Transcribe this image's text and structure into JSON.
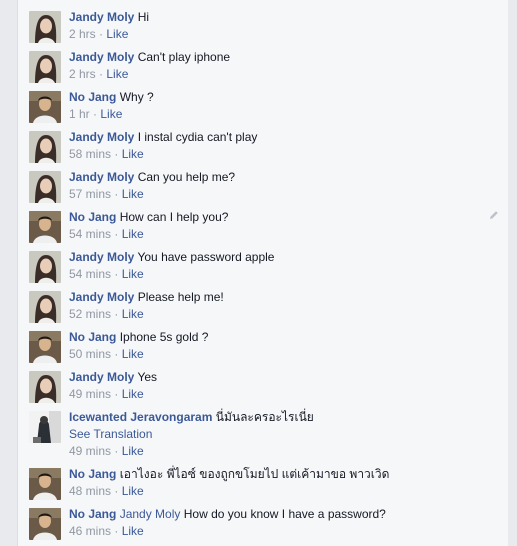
{
  "comments": [
    {
      "author": "Jandy Moly",
      "text": "Hi",
      "time": "2 hrs",
      "like": "Like",
      "avatar": "girl"
    },
    {
      "author": "Jandy Moly",
      "text": "Can't play iphone",
      "time": "2 hrs",
      "like": "Like",
      "avatar": "girl"
    },
    {
      "author": "No Jang",
      "text": "Why ?",
      "time": "1 hr",
      "like": "Like",
      "avatar": "man"
    },
    {
      "author": "Jandy Moly",
      "text": "I instal cydia can't play",
      "time": "58 mins",
      "like": "Like",
      "avatar": "girl"
    },
    {
      "author": "Jandy Moly",
      "text": "Can you help me?",
      "time": "57 mins",
      "like": "Like",
      "avatar": "girl"
    },
    {
      "author": "No Jang",
      "text": "How can I help you?",
      "time": "54 mins",
      "like": "Like",
      "avatar": "man"
    },
    {
      "author": "Jandy Moly",
      "text": "You have password apple",
      "time": "54 mins",
      "like": "Like",
      "avatar": "girl"
    },
    {
      "author": "Jandy Moly",
      "text": "Please help me!",
      "time": "52 mins",
      "like": "Like",
      "avatar": "girl"
    },
    {
      "author": "No Jang",
      "text": "Iphone 5s gold ?",
      "time": "50 mins",
      "like": "Like",
      "avatar": "man"
    },
    {
      "author": "Jandy Moly",
      "text": "Yes",
      "time": "49 mins",
      "like": "Like",
      "avatar": "girl"
    },
    {
      "author": "Icewanted Jeravongaram",
      "text": "นี่มันละครอะไรเนี่ย",
      "see_translation": "See Translation",
      "time": "49 mins",
      "like": "Like",
      "avatar": "ice"
    },
    {
      "author": "No Jang",
      "text": "เอาไงอะ พี่ไอซ์ ของถูกขโมยไป แต่เค้ามาขอ พาวเวิด",
      "time": "48 mins",
      "like": "Like",
      "avatar": "man"
    },
    {
      "author": "No Jang",
      "tag": "Jandy Moly",
      "text": "How do you know I have a password?",
      "time": "46 mins",
      "like": "Like",
      "avatar": "man"
    }
  ],
  "separator": "·",
  "colors": {
    "link": "#3b5998",
    "meta": "#9197a3",
    "text": "#141823",
    "panel": "#f6f7f8",
    "page": "#e9eaed"
  }
}
